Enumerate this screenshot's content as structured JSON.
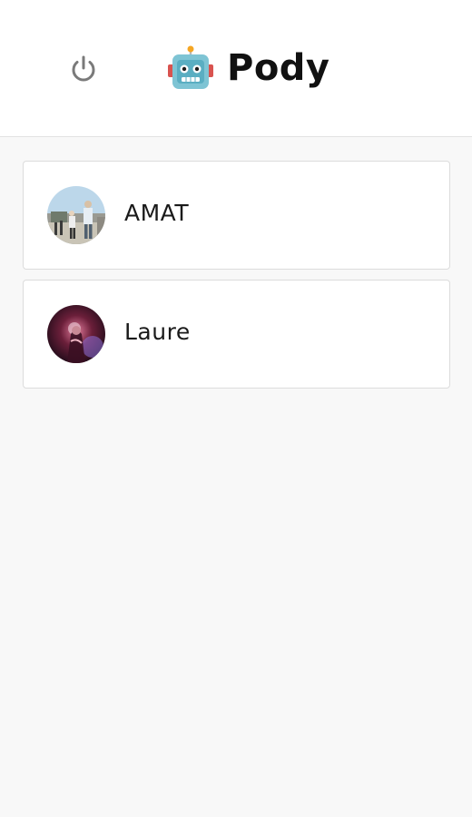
{
  "header": {
    "app_name": "Pody",
    "power_icon": "power-icon",
    "logo_icon": "robot-icon"
  },
  "channels": [
    {
      "name": "AMAT",
      "avatar": "concert-photo-avatar"
    },
    {
      "name": "Laure",
      "avatar": "stage-lights-photo-avatar"
    }
  ],
  "colors": {
    "header_bg": "#ffffff",
    "page_bg": "#f8f8f8",
    "card_border": "#dcdcdc",
    "title_text": "#111111",
    "icon_gray": "#7a7a7a"
  }
}
